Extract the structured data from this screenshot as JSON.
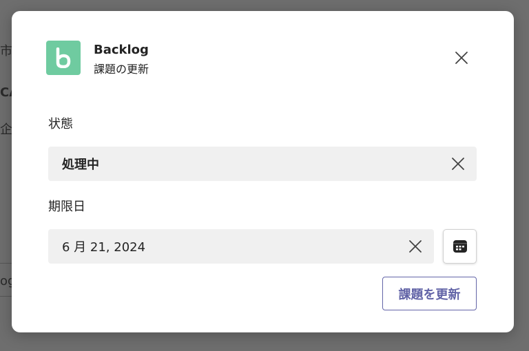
{
  "background": {
    "fragments": [
      "市",
      "CA",
      "企",
      "og"
    ]
  },
  "dialog": {
    "app_name": "Backlog",
    "subtitle": "課題の更新",
    "app_logo_letter": "b",
    "app_logo_color": "#6fcba0",
    "close_icon": "close-icon",
    "status": {
      "label": "状態",
      "value": "処理中",
      "clear_icon": "close-icon"
    },
    "due_date": {
      "label": "期限日",
      "value": "6 月 21, 2024",
      "clear_icon": "close-icon",
      "calendar_icon": "calendar-icon"
    },
    "submit_label": "課題を更新",
    "accent_color": "#6264a7"
  }
}
